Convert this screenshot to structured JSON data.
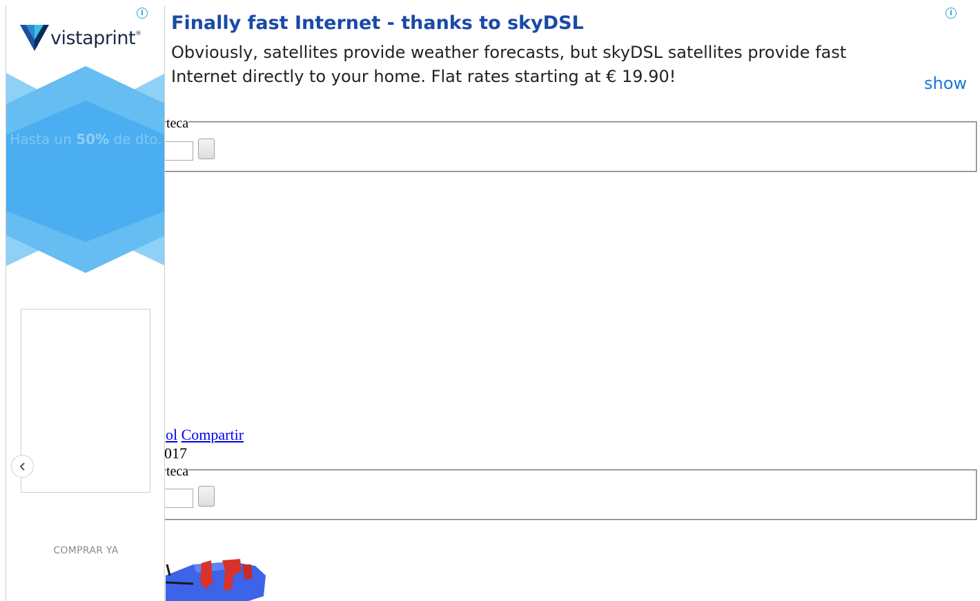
{
  "top_ad": {
    "title": "Finally fast Internet - thanks to skyDSL",
    "text": "Obviously, satellites provide weather forecasts, but skyDSL satellites provide fast Internet directly to your home. Flat rates starting at € 19.90!",
    "show_label": "show",
    "info_glyph": "i"
  },
  "search_top": {
    "legend": "teca"
  },
  "search_bottom": {
    "legend": "teca"
  },
  "links": {
    "partial_link": "ol",
    "share": "Compartir"
  },
  "date_fragment": "017",
  "side_ad": {
    "brand": "vistaprint",
    "brand_mark": "®",
    "promo_prefix": "Hasta un ",
    "promo_highlight": "50%",
    "promo_suffix": " de dto.",
    "cta": "COMPRAR YA",
    "info_glyph": "i"
  },
  "colors": {
    "ad_title": "#1a4aa8",
    "ad_show": "#1a73d9",
    "info": "#2aa3d6",
    "hex_dark": "#4aaef0",
    "hex_light": "#8fd0f7",
    "brand_navy": "#1b2a4a",
    "thumb_blue": "#3c63e8",
    "thumb_red": "#d8322a"
  },
  "icons": [
    "info-icon",
    "chevron-left-icon",
    "vistaprint-logo-icon"
  ]
}
